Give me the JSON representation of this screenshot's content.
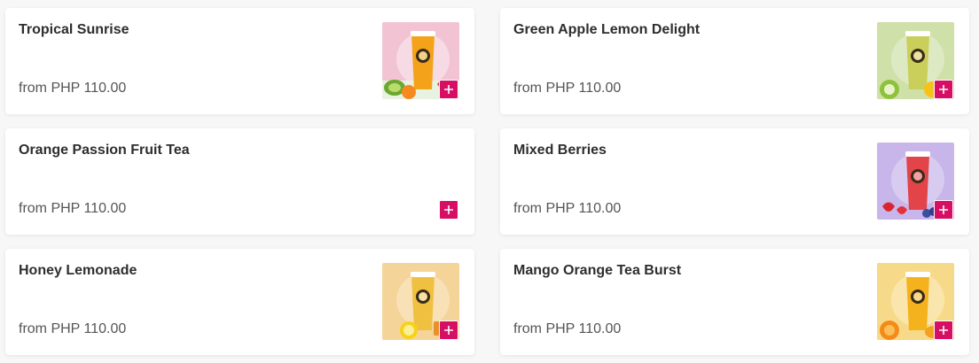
{
  "products": [
    {
      "name": "Tropical Sunrise",
      "price": "from PHP 110.00",
      "has_image": true,
      "bg": "#f2c4d3",
      "drink": "#f3a21a",
      "fruit": "kiwi-orange-strawberry"
    },
    {
      "name": "Green Apple Lemon Delight",
      "price": "from PHP 110.00",
      "has_image": true,
      "bg": "#cfe0a8",
      "drink": "#c9cf5a",
      "fruit": "apple-lemon"
    },
    {
      "name": "Orange Passion Fruit Tea",
      "price": "from PHP 110.00",
      "has_image": false
    },
    {
      "name": "Mixed Berries",
      "price": "from PHP 110.00",
      "has_image": true,
      "bg": "#c8b6ea",
      "drink": "#e2444a",
      "fruit": "strawberry-blueberry"
    },
    {
      "name": "Honey Lemonade",
      "price": "from PHP 110.00",
      "has_image": true,
      "bg": "#f5d49a",
      "drink": "#f0c040",
      "fruit": "lemon-honeycomb"
    },
    {
      "name": "Mango Orange Tea Burst",
      "price": "from PHP 110.00",
      "has_image": true,
      "bg": "#f7d98a",
      "drink": "#f4b21c",
      "fruit": "orange-mango"
    }
  ],
  "colors": {
    "accent": "#d70f64"
  },
  "icons": {
    "add": "plus-icon"
  }
}
